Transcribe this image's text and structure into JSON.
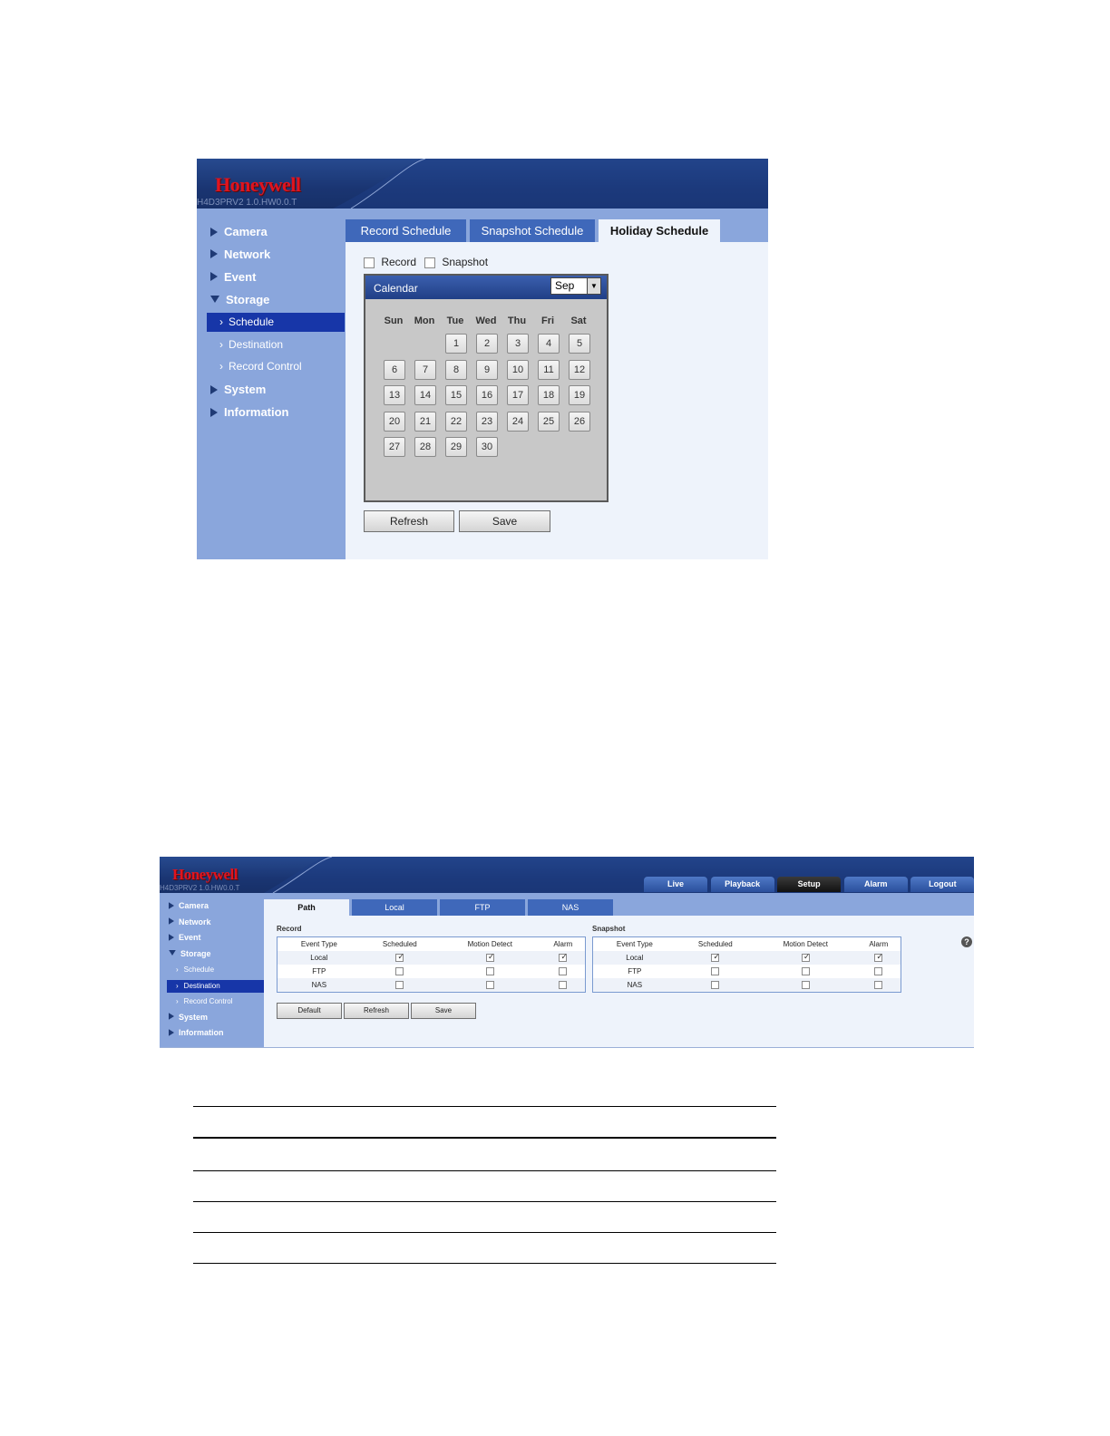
{
  "screen1": {
    "brand": "Honeywell",
    "version": "H4D3PRV2  1.0.HW0.0.T",
    "nav": [
      {
        "label": "Camera",
        "expanded": false
      },
      {
        "label": "Network",
        "expanded": false
      },
      {
        "label": "Event",
        "expanded": false
      },
      {
        "label": "Storage",
        "expanded": true
      },
      {
        "label": "System",
        "expanded": false
      },
      {
        "label": "Information",
        "expanded": false
      }
    ],
    "storage_sub": [
      {
        "label": "Schedule",
        "selected": true
      },
      {
        "label": "Destination",
        "selected": false
      },
      {
        "label": "Record Control",
        "selected": false
      }
    ],
    "tabs": [
      "Record Schedule",
      "Snapshot Schedule",
      "Holiday Schedule"
    ],
    "active_tab": "Holiday Schedule",
    "checkboxes": [
      {
        "label": "Record",
        "checked": false
      },
      {
        "label": "Snapshot",
        "checked": false
      }
    ],
    "calendar": {
      "title": "Calendar",
      "month": "Sep",
      "weekdays": [
        "Sun",
        "Mon",
        "Tue",
        "Wed",
        "Thu",
        "Fri",
        "Sat"
      ],
      "first_weekday_index": 2,
      "days": [
        "1",
        "2",
        "3",
        "4",
        "5",
        "6",
        "7",
        "8",
        "9",
        "10",
        "11",
        "12",
        "13",
        "14",
        "15",
        "16",
        "17",
        "18",
        "19",
        "20",
        "21",
        "22",
        "23",
        "24",
        "25",
        "26",
        "27",
        "28",
        "29",
        "30"
      ]
    },
    "buttons": {
      "refresh": "Refresh",
      "save": "Save"
    }
  },
  "screen2": {
    "brand": "Honeywell",
    "version": "H4D3PRV2  1.0.HW0.0.T",
    "top_tabs": [
      "Live",
      "Playback",
      "Setup",
      "Alarm",
      "Logout"
    ],
    "active_top_tab": "Setup",
    "help": "?",
    "nav": [
      {
        "label": "Camera",
        "expanded": false
      },
      {
        "label": "Network",
        "expanded": false
      },
      {
        "label": "Event",
        "expanded": false
      },
      {
        "label": "Storage",
        "expanded": true
      },
      {
        "label": "System",
        "expanded": false
      },
      {
        "label": "Information",
        "expanded": false
      }
    ],
    "storage_sub": [
      {
        "label": "Schedule",
        "selected": false
      },
      {
        "label": "Destination",
        "selected": true
      },
      {
        "label": "Record Control",
        "selected": false
      }
    ],
    "tabs": [
      "Path",
      "Local",
      "FTP",
      "NAS"
    ],
    "active_tab": "Path",
    "record": {
      "title": "Record",
      "headers": [
        "Event Type",
        "Scheduled",
        "Motion Detect",
        "Alarm"
      ],
      "rows": [
        {
          "type": "Local",
          "checks": [
            true,
            true,
            true
          ]
        },
        {
          "type": "FTP",
          "checks": [
            false,
            false,
            false
          ]
        },
        {
          "type": "NAS",
          "checks": [
            false,
            false,
            false
          ]
        }
      ]
    },
    "snapshot": {
      "title": "Snapshot",
      "headers": [
        "Event Type",
        "Scheduled",
        "Motion Detect",
        "Alarm"
      ],
      "rows": [
        {
          "type": "Local",
          "checks": [
            true,
            true,
            true
          ]
        },
        {
          "type": "FTP",
          "checks": [
            false,
            false,
            false
          ]
        },
        {
          "type": "NAS",
          "checks": [
            false,
            false,
            false
          ]
        }
      ]
    },
    "buttons": {
      "default": "Default",
      "refresh": "Refresh",
      "save": "Save"
    }
  }
}
